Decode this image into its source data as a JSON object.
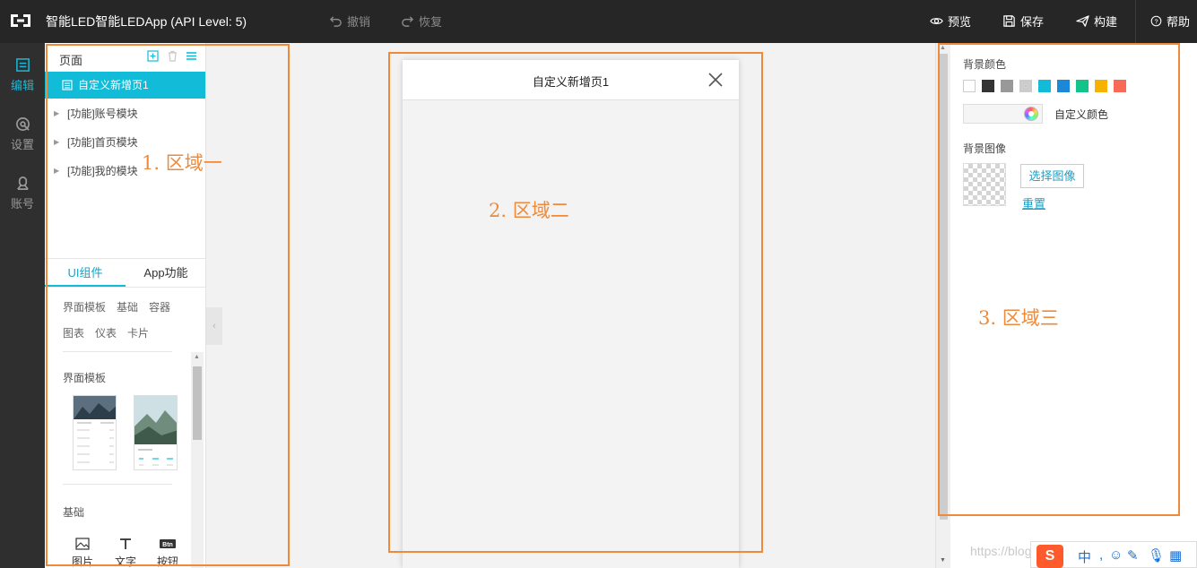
{
  "app": {
    "title": "智能LED智能LEDApp (API Level: 5)"
  },
  "toolbar": {
    "undo": "撤销",
    "redo": "恢复",
    "preview": "预览",
    "save": "保存",
    "build": "构建",
    "help": "帮助"
  },
  "rail": {
    "items": [
      {
        "label": "编辑",
        "icon": "edit-icon",
        "active": true
      },
      {
        "label": "设置",
        "icon": "settings-icon",
        "active": false
      },
      {
        "label": "账号",
        "icon": "account-icon",
        "active": false
      }
    ]
  },
  "pages": {
    "title": "页面",
    "items": [
      {
        "label": "自定义新增页1",
        "active": true
      },
      {
        "label": "[功能]账号模块",
        "active": false
      },
      {
        "label": "[功能]首页模块",
        "active": false
      },
      {
        "label": "[功能]我的模块",
        "active": false
      }
    ]
  },
  "component_tabs": [
    {
      "label": "UI组件",
      "active": true
    },
    {
      "label": "App功能",
      "active": false
    }
  ],
  "categories": [
    "界面模板",
    "基础",
    "容器",
    "图表",
    "仪表",
    "卡片"
  ],
  "sections": {
    "templates": "界面模板",
    "basic": "基础"
  },
  "basic_items": [
    {
      "label": "图片",
      "icon": "image-icon"
    },
    {
      "label": "文字",
      "icon": "text-icon"
    },
    {
      "label": "按钮",
      "icon": "button-icon",
      "badge": "Btn"
    }
  ],
  "phone": {
    "title": "自定义新增页1"
  },
  "properties": {
    "bg_color_label": "背景颜色",
    "swatches": [
      "#ffffff",
      "#333333",
      "#999999",
      "#cccccc",
      "#12bcd8",
      "#1e88d8",
      "#13c48a",
      "#f7b200",
      "#f86a55"
    ],
    "custom_color_label": "自定义颜色",
    "bg_image_label": "背景图像",
    "select_image": "选择图像",
    "reset": "重置"
  },
  "annotations": {
    "zone1": "1. 区域一",
    "zone2": "2.  区域二",
    "zone3": "3. 区域三"
  },
  "watermark": "https://blog.csdn.net/",
  "ime": {
    "logo": "S",
    "lang": "中"
  }
}
